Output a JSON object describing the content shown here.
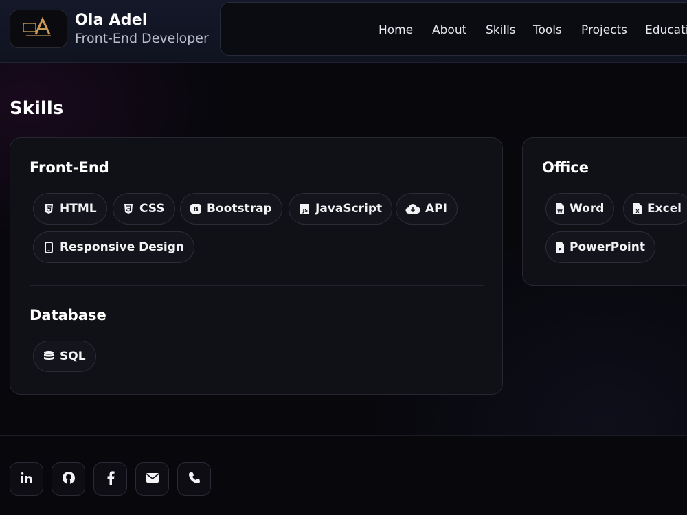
{
  "header": {
    "brand_name": "Ola Adel",
    "brand_role": "Front-End Developer",
    "nav": [
      "Home",
      "About",
      "Skills",
      "Tools",
      "Projects",
      "Educatio"
    ]
  },
  "skills": {
    "title": "Skills",
    "frontend": {
      "title": "Front-End",
      "items": [
        {
          "label": "HTML",
          "icon": "html5-icon"
        },
        {
          "label": "CSS",
          "icon": "css3-icon"
        },
        {
          "label": "Bootstrap",
          "icon": "bootstrap-icon"
        },
        {
          "label": "JavaScript",
          "icon": "javascript-icon"
        },
        {
          "label": "API",
          "icon": "cloud-download-icon"
        },
        {
          "label": "Responsive Design",
          "icon": "mobile-icon"
        }
      ]
    },
    "database": {
      "title": "Database",
      "items": [
        {
          "label": "SQL",
          "icon": "database-icon"
        }
      ]
    },
    "office": {
      "title": "Office",
      "items": [
        {
          "label": "Word",
          "icon": "word-file-icon"
        },
        {
          "label": "Excel",
          "icon": "excel-file-icon"
        },
        {
          "label": "PowerPoint",
          "icon": "powerpoint-file-icon"
        }
      ]
    }
  },
  "footer": {
    "socials": [
      "linkedin-icon",
      "github-icon",
      "facebook-icon",
      "envelope-icon",
      "phone-icon"
    ]
  },
  "colors": {
    "background": "#07070c",
    "card": "#101017",
    "chip": "#14141c",
    "text": "#f1f1f4"
  }
}
